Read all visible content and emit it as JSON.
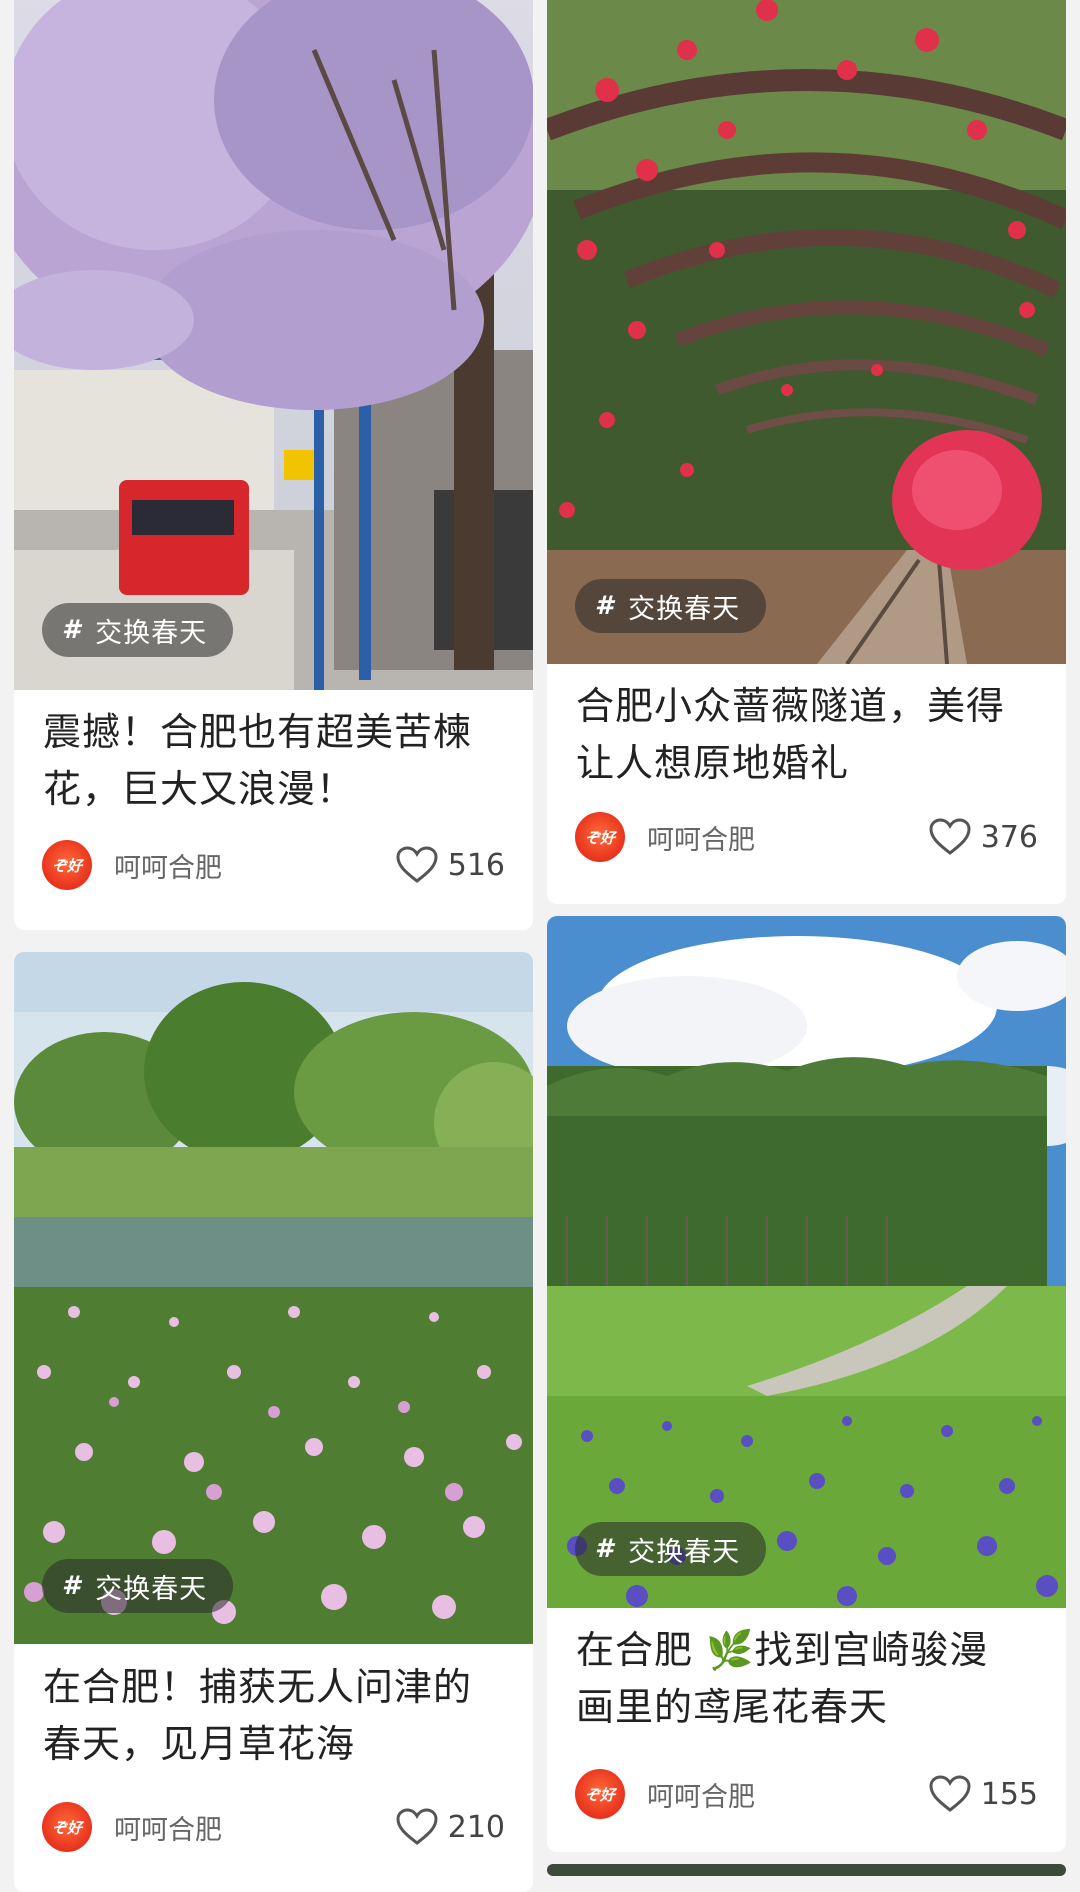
{
  "cards": [
    {
      "tag_hash": "#",
      "tag": "交换春天",
      "title_line1": "震撼！合肥也有超美苦楝",
      "title_line2": "花，巨大又浪漫！",
      "author": "呵呵合肥",
      "likes": "516",
      "avatar_text": "ぞ好"
    },
    {
      "tag_hash": "#",
      "tag": "交换春天",
      "title_line1": "合肥小众蔷薇隧道，美得",
      "title_line2": "让人想原地婚礼",
      "author": "呵呵合肥",
      "likes": "376",
      "avatar_text": "ぞ好"
    },
    {
      "tag_hash": "#",
      "tag": "交换春天",
      "title_line1": "在合肥！捕获无人问津的",
      "title_line2": "春天，见月草花海",
      "author": "呵呵合肥",
      "likes": "210",
      "avatar_text": "ぞ好"
    },
    {
      "tag_hash": "#",
      "tag": "交换春天",
      "title_line1": "在合肥 🌿找到宫崎骏漫",
      "title_line2": "画里的鸢尾花春天",
      "author": "呵呵合肥",
      "likes": "155",
      "avatar_text": "ぞ好"
    }
  ],
  "icons": {
    "like": "heart-outline-icon",
    "tag": "hashtag-icon"
  },
  "colors": {
    "avatar": "#e8321d",
    "background": "#f2f2f2",
    "card": "#ffffff"
  }
}
